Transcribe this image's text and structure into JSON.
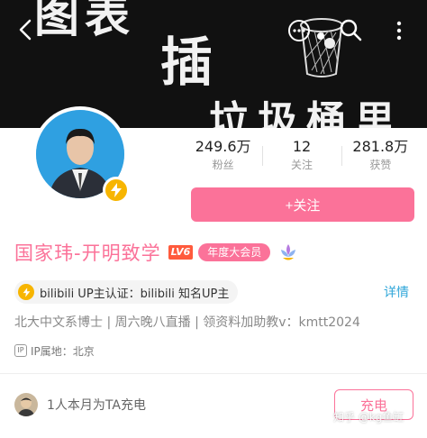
{
  "banner": {
    "line1": "图表",
    "line2": "插",
    "line3": "垃圾桶里"
  },
  "stats": [
    {
      "value": "249.6万",
      "label": "粉丝"
    },
    {
      "value": "12",
      "label": "关注"
    },
    {
      "value": "281.8万",
      "label": "获赞"
    }
  ],
  "follow_button": "+关注",
  "profile": {
    "name": "国家玮-开明致学",
    "level": "LV6",
    "vip_badge": "年度大会员",
    "certification": "bilibili UP主认证：bilibili 知名UP主",
    "detail_link": "详情",
    "bio": "北大中文系博士 | 周六晚八直播 | 领资料加助教v：kmtt2024",
    "ip_icon": "IP",
    "ip_location": "IP属地：北京"
  },
  "charge": {
    "text": "1人本月为TA充电",
    "button": "充电"
  },
  "watermark": "知乎 @kg鱼缸",
  "colors": {
    "accent_pink": "#fb7299",
    "bolt_yellow": "#f7b500",
    "link_blue": "#2fa6d9"
  }
}
